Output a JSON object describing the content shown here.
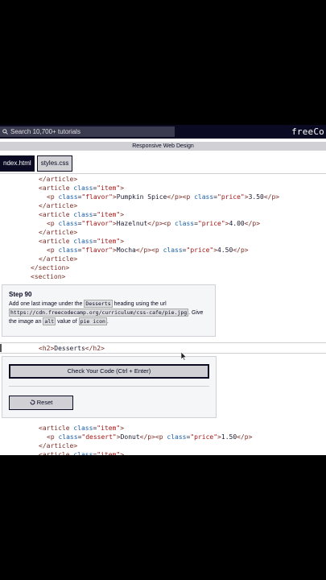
{
  "nav": {
    "search_placeholder": "Search 10,700+ tutorials",
    "brand": "freeCo"
  },
  "breadcrumb": "Responsive Web Design",
  "tabs": [
    {
      "label": "ndex.html",
      "active": true
    },
    {
      "label": "styles.css",
      "active": false
    }
  ],
  "step": {
    "title": "Step 90",
    "text_1": "Add one last image under the ",
    "code_desserts": "Desserts",
    "text_2": " heading using the url ",
    "code_url": "https://cdn.freecodecamp.org/curriculum/css-cafe/pie.jpg",
    "text_3": ". Give the image an ",
    "code_alt": "alt",
    "text_4": " value of ",
    "code_value": "pie icon",
    "text_5": "."
  },
  "buttons": {
    "check": "Check Your Code (Ctrl + Enter)",
    "reset": "Reset"
  },
  "colors": {
    "nav_bg": "#0a0a23",
    "panel_bg": "#f5f6f7"
  }
}
